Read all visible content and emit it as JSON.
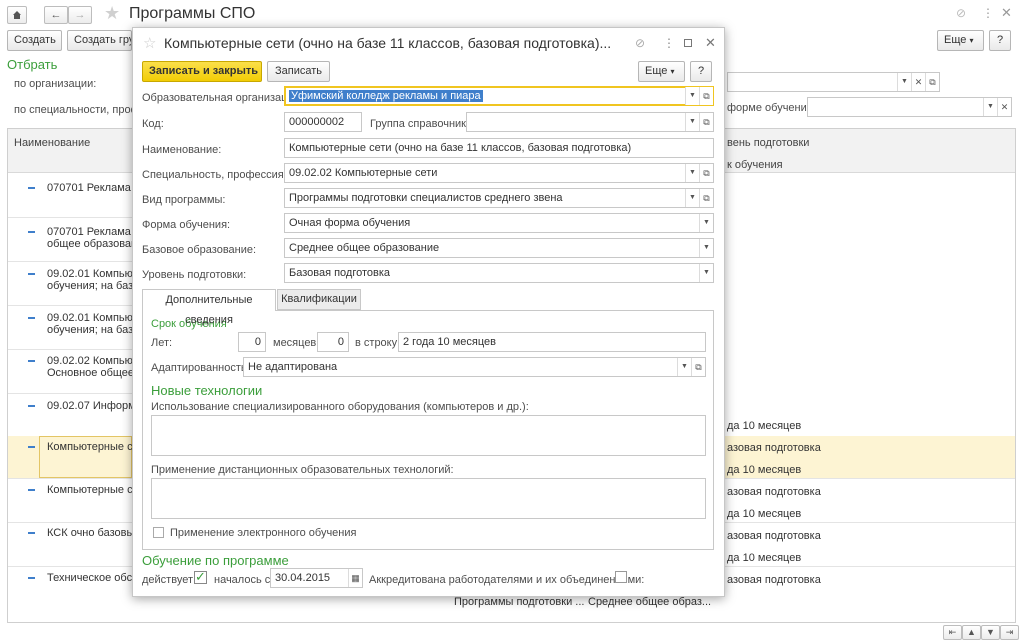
{
  "window": {
    "title": "Программы СПО",
    "link_icon": "link-icon",
    "menu_icon": "more-vert-icon",
    "close_icon": "close-icon"
  },
  "toolbar": {
    "create_label": "Создать",
    "create_group_label": "Создать гру",
    "more_label": "Еще",
    "help_label": "?"
  },
  "filter": {
    "title": "Отбрать",
    "by_org_label": "по организации:",
    "by_spec_label": "по специальности, профес",
    "by_form_label": "форме обучения:"
  },
  "list": {
    "col_name": "Наименование",
    "col_level": "вень подготовки",
    "col_term": "к обучения",
    "rows": [
      {
        "line1": "070701    Реклама",
        "line2": ""
      },
      {
        "line1": "070701    Реклама",
        "line2": "общее образовани"
      },
      {
        "line1": "09.02.01  Компьют",
        "line2": "обучения; на базе:"
      },
      {
        "line1": "09.02.01  Компьют",
        "line2": "обучения; на базе:"
      },
      {
        "line1": "09.02.02  Компьют",
        "line2": "Основное общее о"
      },
      {
        "line1": "09.02.07  Информа",
        "line2": ""
      },
      {
        "line1": "Компьютерные сет",
        "line2": ""
      },
      {
        "line1": "Компьютерные сет",
        "line2": ""
      },
      {
        "line1": "КСК очно базовый",
        "line2": ""
      },
      {
        "line1": "Техническое обслу",
        "line2": ""
      }
    ],
    "right_cells": [
      {
        "text": "да 10 месяцев"
      },
      {
        "text": "азовая подготовка"
      },
      {
        "text": "да 10 месяцев"
      },
      {
        "text": "азовая подготовка"
      },
      {
        "text": "да 10 месяцев"
      },
      {
        "text": "азовая подготовка"
      },
      {
        "text": "да 10 месяцев"
      },
      {
        "text": "азовая подготовка"
      }
    ],
    "bottom_row": {
      "program": "Программы подготовки ...",
      "education": "Среднее общее образ..."
    }
  },
  "dialog": {
    "title": "Компьютерные сети (очно на базе 11 классов, базовая подготовка)...",
    "save_close_label": "Записать и закрыть",
    "save_label": "Записать",
    "more_label": "Еще",
    "help_label": "?",
    "fields": {
      "org_label": "Образовательная организация:",
      "org_value": "Уфимский колледж рекламы и пиара",
      "code_label": "Код:",
      "code_value": "000000002",
      "group_label": "Группа справочника:",
      "group_value": "",
      "name_label": "Наименование:",
      "name_value": "Компьютерные сети (очно на базе 11 классов, базовая подготовка)",
      "spec_label": "Специальность, профессия:",
      "spec_value": "09.02.02   Компьютерные сети",
      "kind_label": "Вид программы:",
      "kind_value": "Программы подготовки специалистов среднего звена",
      "form_label": "Форма обучения:",
      "form_value": "Очная форма обучения",
      "base_label": "Базовое образование:",
      "base_value": "Среднее общее образование",
      "level_label": "Уровень подготовки:",
      "level_value": "Базовая подготовка"
    },
    "tabs": [
      {
        "label": "Дополнительные сведения"
      },
      {
        "label": "Квалификации"
      }
    ],
    "term": {
      "title": "Срок обучения",
      "years_label": "Лет:",
      "years_value": "0",
      "months_label": "месяцев:",
      "months_value": "0",
      "string_label": "в строку:",
      "string_value": "2 года 10 месяцев"
    },
    "adapt_label": "Адаптированность:",
    "adapt_value": "Не адаптирована",
    "tech": {
      "title": "Новые технологии",
      "equipment_label": "Использование специализированного оборудования (компьютеров и др.):",
      "distance_label": "Применение дистанционных образовательных технологий:",
      "elearning_label": "Применение электронного обучения"
    },
    "program": {
      "title": "Обучение по программе",
      "active_label": "действует:",
      "started_label": "началось с:",
      "started_value": "30.04.2015",
      "accredited_label": "Аккредитована работодателями и их объединениями:"
    }
  },
  "colors": {
    "accent_green": "#3b9e3b",
    "primary_button": "#f5d300",
    "highlight_row": "#fdf4d3",
    "selection": "#3f7fcb"
  }
}
